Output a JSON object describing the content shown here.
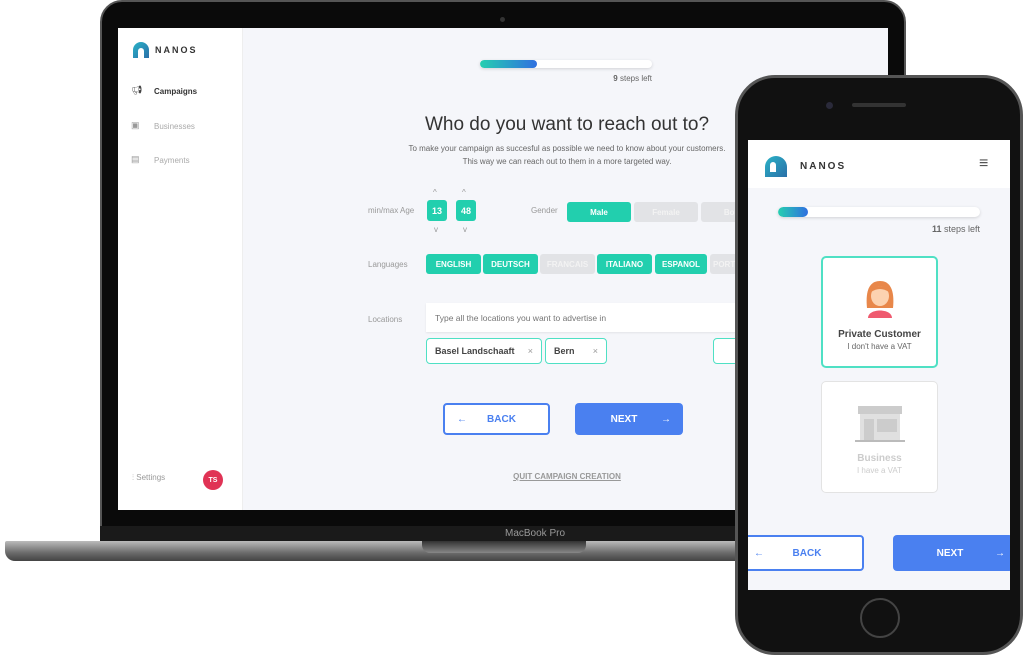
{
  "laptop": {
    "brand": "NANOS",
    "device_label": "MacBook Pro",
    "sidebar": {
      "items": [
        {
          "label": "Campaigns",
          "icon": "megaphone-icon",
          "active": true
        },
        {
          "label": "Businesses",
          "icon": "briefcase-icon"
        },
        {
          "label": "Payments",
          "icon": "payment-icon"
        }
      ],
      "settings": "Settings",
      "avatar": "TS",
      "avatar_color": "#e03355"
    },
    "progress": {
      "value": 0.33,
      "steps_count": "9",
      "steps_text": "steps left"
    },
    "title": "Who do you want to reach out to?",
    "subtitle_1": "To make your campaign as succesful as possible we need to know about your customers.",
    "subtitle_2": "This way we can reach out to them in a more targeted way.",
    "age": {
      "label": "min/max Age",
      "min": "13",
      "max": "48",
      "up": "^",
      "down": "v"
    },
    "gender": {
      "label": "Gender",
      "options": [
        {
          "label": "Male",
          "selected": true
        },
        {
          "label": "Female",
          "selected": false
        },
        {
          "label": "Both",
          "selected": false
        }
      ]
    },
    "languages": {
      "label": "Languages",
      "options": [
        {
          "label": "ENGLISH",
          "selected": true
        },
        {
          "label": "DEUTSCH",
          "selected": true
        },
        {
          "label": "FRANCAIS",
          "selected": false
        },
        {
          "label": "ITALIANO",
          "selected": true
        },
        {
          "label": "ESPANOL",
          "selected": true
        },
        {
          "label": "PORTUGUES",
          "selected": false
        }
      ]
    },
    "locations": {
      "label": "Locations",
      "placeholder": "Type all the locations you want to advertise in",
      "chips": [
        "Basel Landschaaft",
        "Bern"
      ],
      "remove": "×"
    },
    "back": "BACK",
    "next": "NEXT",
    "arrow_left": "←",
    "arrow_right": "→",
    "quit": "QUIT CAMPAIGN CREATION"
  },
  "phone": {
    "brand": "NANOS",
    "menu": "≡",
    "progress": {
      "value": 0.15,
      "steps_count": "11",
      "steps_text": "steps left"
    },
    "cards": [
      {
        "title": "Private Customer",
        "subtitle": "I don't have a VAT",
        "selected": true
      },
      {
        "title": "Business",
        "subtitle": "I have a VAT",
        "selected": false
      }
    ],
    "back": "BACK",
    "next": "NEXT",
    "arrow_left": "←",
    "arrow_right": "→"
  },
  "colors": {
    "teal": "#22cfae",
    "blue": "#4a80f0",
    "bg": "#f5f6fa"
  }
}
